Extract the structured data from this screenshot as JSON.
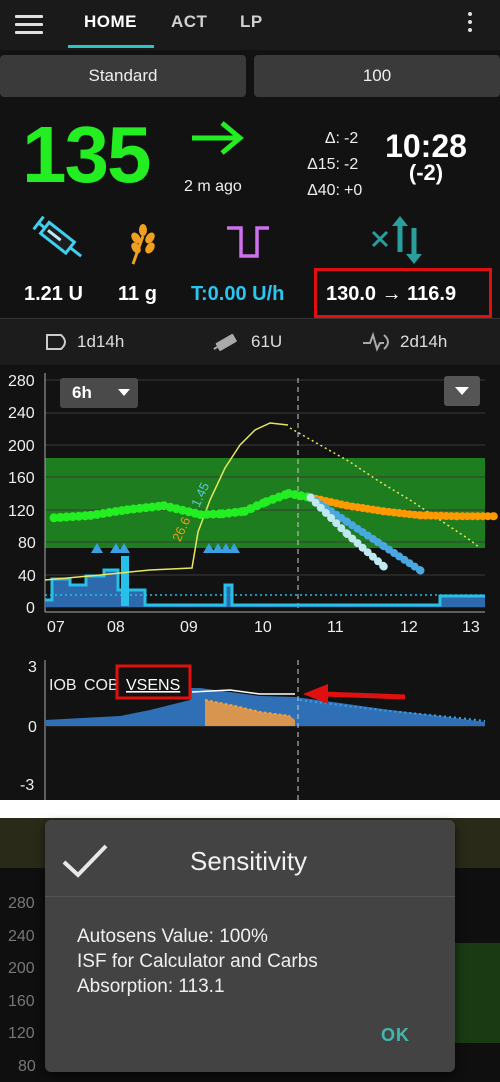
{
  "tabs": [
    {
      "label": "HOME"
    },
    {
      "label": "ACT"
    },
    {
      "label": "LP"
    }
  ],
  "profile_buttons": {
    "profile": "Standard",
    "percent": "100"
  },
  "bg": {
    "value": "135",
    "ago": "2 m ago",
    "arrow_icon": "arrow-right-icon",
    "color": "#22ee22"
  },
  "deltas": {
    "d": "-2",
    "d15": "-2",
    "d40": "+0",
    "d_label": "Δ:",
    "d15_label": "Δ15:",
    "d40_label": "Δ40:"
  },
  "clock": {
    "time": "10:28",
    "diff": "(-2)"
  },
  "stats": {
    "iob": "1.21 U",
    "cob": "11 g",
    "temp_basal": "T:0.00 U/h",
    "autosens": "130.0 → 116.9"
  },
  "status_row": {
    "cannula": "1d14h",
    "reservoir": "61U",
    "sensor": "2d14h"
  },
  "chart_main": {
    "range_label": "6h",
    "y_ticks": [
      "280",
      "240",
      "200",
      "160",
      "120",
      "80",
      "40",
      "0"
    ],
    "x_ticks": [
      "07",
      "08",
      "09",
      "10",
      "11",
      "12",
      "13"
    ],
    "annotations": [
      "1.45",
      "26.6"
    ]
  },
  "chart_sub": {
    "y_ticks": [
      "3",
      "0",
      "-3"
    ],
    "legend_iob": "IOB",
    "legend_cob": "COB",
    "legend_vsens": "VSENS"
  },
  "dialog": {
    "title": "Sensitivity",
    "autosens": "Autosens Value: 100%",
    "isf": "ISF for Calculator and Carbs",
    "absorption": "Absorption: 113.1",
    "ok": "OK"
  },
  "bg_screen2_ticks": [
    "280",
    "240",
    "200",
    "160",
    "120",
    "80"
  ],
  "chart_data": [
    {
      "type": "scatter",
      "x_ticks": [
        "07",
        "08",
        "09",
        "10",
        "11",
        "12",
        "13"
      ],
      "ylim": [
        0,
        280
      ],
      "series": [
        {
          "name": "BG",
          "color": "#22ee22",
          "x": [
            7,
            7.5,
            8,
            8.5,
            9,
            9.3,
            9.6,
            9.9,
            10.2,
            10.5
          ],
          "y": [
            110,
            113,
            120,
            125,
            114,
            115,
            118,
            130,
            140,
            135
          ]
        },
        {
          "name": "prediction",
          "color": "#ff9900",
          "x": [
            10.5,
            11,
            11.5,
            12,
            12.5,
            13
          ],
          "y": [
            135,
            125,
            118,
            113,
            112,
            112
          ]
        },
        {
          "name": "prediction",
          "color": "#4aa8e0",
          "x": [
            10.5,
            11,
            11.5,
            12
          ],
          "y": [
            135,
            105,
            75,
            45
          ]
        },
        {
          "name": "prediction",
          "color": "#c0e8f0",
          "x": [
            10.5,
            11,
            11.5
          ],
          "y": [
            135,
            90,
            50
          ]
        }
      ]
    },
    {
      "type": "area",
      "x_ticks": [
        "07",
        "08",
        "09",
        "10",
        "11",
        "12",
        "13"
      ],
      "ylim": [
        -3,
        3
      ],
      "series": [
        {
          "name": "IOB",
          "color": "#2f6fb6"
        },
        {
          "name": "COB",
          "color": "#e0a050"
        },
        {
          "name": "VSENS",
          "color": "#ffffff"
        }
      ]
    }
  ],
  "colors": {
    "accent": "#2bc5c5",
    "basal": "#26c0e8",
    "target_band": "#1e7d1e",
    "red_box": "#e01010"
  }
}
